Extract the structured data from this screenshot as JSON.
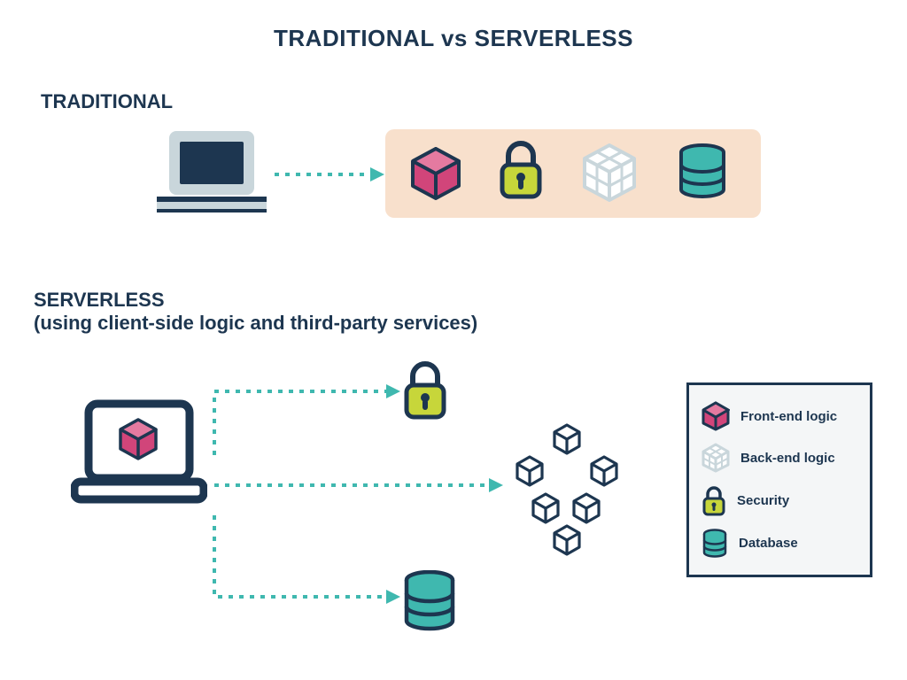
{
  "title": "TRADITIONAL vs SERVERLESS",
  "traditional": {
    "heading": "TRADITIONAL"
  },
  "serverless": {
    "heading": "SERVERLESS",
    "subheading": "(using client-side logic and third-party services)"
  },
  "legend": {
    "frontend": "Front-end logic",
    "backend": "Back-end logic",
    "security": "Security",
    "database": "Database"
  },
  "colors": {
    "navy": "#1d3650",
    "teal": "#3fb8af",
    "pink": "#d1457a",
    "lime": "#c7d63a",
    "gray": "#c9d6db",
    "peach": "#f8e0cc",
    "white": "#ffffff"
  }
}
